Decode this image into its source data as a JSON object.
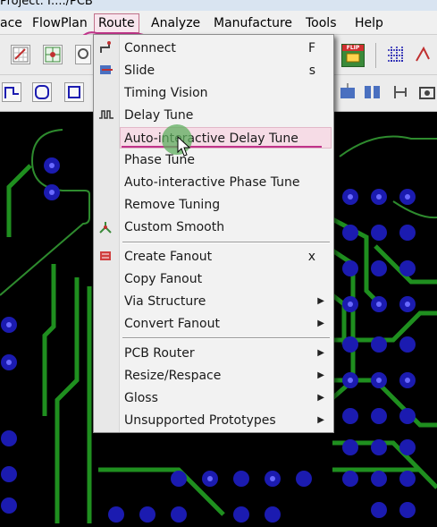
{
  "window": {
    "title": "Project: I:.../PCB"
  },
  "menubar": {
    "items": [
      {
        "label": "ace"
      },
      {
        "label": "FlowPlan"
      },
      {
        "label": "Route"
      },
      {
        "label": "Analyze"
      },
      {
        "label": "Manufacture"
      },
      {
        "label": "Tools"
      },
      {
        "label": "Help"
      }
    ]
  },
  "route_menu": {
    "items": [
      {
        "label": "Connect",
        "shortcut": "F"
      },
      {
        "label": "Slide",
        "shortcut": "s"
      },
      {
        "label": "Timing Vision"
      },
      {
        "label": "Delay Tune"
      },
      {
        "label": "Auto-interactive Delay Tune"
      },
      {
        "label": "Phase Tune"
      },
      {
        "label": "Auto-interactive Phase Tune"
      },
      {
        "label": "Remove Tuning"
      },
      {
        "label": "Custom Smooth"
      },
      {
        "label": "Create Fanout",
        "shortcut": "x"
      },
      {
        "label": "Copy Fanout"
      },
      {
        "label": "Via Structure"
      },
      {
        "label": "Convert Fanout"
      },
      {
        "label": "PCB Router"
      },
      {
        "label": "Resize/Respace"
      },
      {
        "label": "Gloss"
      },
      {
        "label": "Unsupported Prototypes"
      }
    ]
  },
  "toolbar": {
    "flip_label": "FLIP"
  },
  "colors": {
    "trace": "#1f8f1f",
    "via_ring": "#1b1bb0",
    "via_center": "#6a6aff",
    "board_outline": "#2e8b2e",
    "menu_hover": "#f6dce6",
    "annotation": "#c0338a"
  }
}
